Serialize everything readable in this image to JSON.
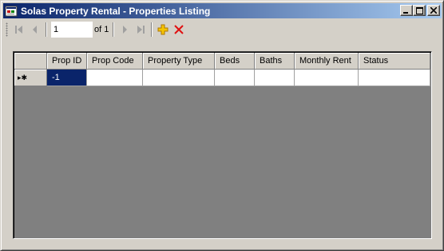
{
  "window": {
    "title": "Solas Property Rental - Properties Listing"
  },
  "caption": {
    "minimize": "_",
    "maximize": "□",
    "close": "✕"
  },
  "navigator": {
    "position": "1",
    "count_label": "of 1"
  },
  "grid": {
    "columns": [
      "Prop ID",
      "Prop Code",
      "Property Type",
      "Beds",
      "Baths",
      "Monthly Rent",
      "Status"
    ],
    "new_row": {
      "marker": "▸✱",
      "cells": [
        "-1",
        "",
        "",
        "",
        "",
        "",
        ""
      ]
    }
  },
  "icons": {
    "app": "app-form-icon",
    "move_first": "move-first-icon",
    "move_previous": "move-previous-icon",
    "move_next": "move-next-icon",
    "move_last": "move-last-icon",
    "add_new": "add-new-icon",
    "delete": "delete-icon"
  },
  "colors": {
    "titlebar_start": "#0a246a",
    "titlebar_end": "#a6caf0",
    "selection": "#0a246a",
    "grid_background": "#808080"
  }
}
